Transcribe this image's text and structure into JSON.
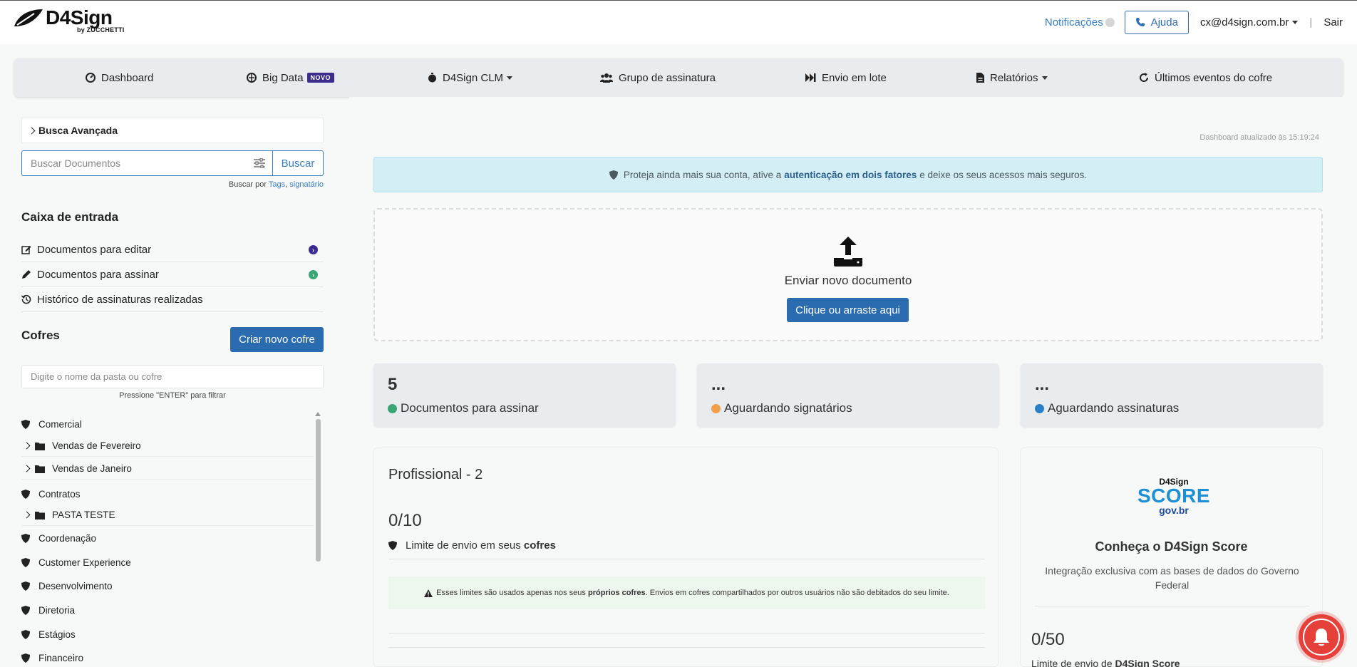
{
  "header": {
    "logo_text": "D4Sign",
    "logo_sub": "by ZUCCHETTI",
    "notifications_label": "Notificações",
    "help_label": "Ajuda",
    "user_email": "cx@d4sign.com.br",
    "separator": "|",
    "logout_label": "Sair"
  },
  "nav": {
    "items": [
      {
        "label": "Dashboard",
        "icon": "dashboard-icon"
      },
      {
        "label": "Big Data",
        "icon": "brain-icon",
        "badge": "NOVO"
      },
      {
        "label": "D4Sign CLM",
        "icon": "stopwatch-icon"
      },
      {
        "label": "Grupo de assinatura",
        "icon": "users-icon"
      },
      {
        "label": "Envio em lote",
        "icon": "fast-forward-icon"
      },
      {
        "label": "Relatórios",
        "icon": "file-report-icon"
      },
      {
        "label": "Últimos eventos do cofre",
        "icon": "refresh-icon"
      }
    ]
  },
  "sidebar": {
    "advanced_search": "Busca Avançada",
    "search_placeholder": "Buscar Documentos",
    "search_button": "Buscar",
    "search_hint_prefix": "Buscar por",
    "search_hint_tags": "Tags",
    "search_hint_sep": ",",
    "search_hint_signer": "signatário",
    "inbox_title": "Caixa de entrada",
    "inbox_items": [
      {
        "label": "Documentos para editar",
        "icon": "edit-icon",
        "badge_color": "#3c2c8f"
      },
      {
        "label": "Documentos para assinar",
        "icon": "pencil-icon",
        "badge_color": "#3aa676"
      },
      {
        "label": "Histórico de assinaturas realizadas",
        "icon": "history-icon"
      }
    ],
    "vaults_title": "Cofres",
    "create_vault_button": "Criar novo cofre",
    "folder_filter_placeholder": "Digite o nome da pasta ou cofre",
    "folder_filter_hint": "Pressione \"ENTER\" para filtrar",
    "tree": [
      {
        "label": "Comercial",
        "type": "vault"
      },
      {
        "label": "Vendas de Fevereiro",
        "type": "folder"
      },
      {
        "label": "Vendas de Janeiro",
        "type": "folder"
      },
      {
        "label": "Contratos",
        "type": "vault"
      },
      {
        "label": "PASTA TESTE",
        "type": "folder"
      },
      {
        "label": "Coordenação",
        "type": "vault"
      },
      {
        "label": "Customer Experience",
        "type": "vault"
      },
      {
        "label": "Desenvolvimento",
        "type": "vault"
      },
      {
        "label": "Diretoria",
        "type": "vault"
      },
      {
        "label": "Estágios",
        "type": "vault"
      },
      {
        "label": "Financeiro",
        "type": "vault"
      }
    ]
  },
  "main": {
    "updated_text": "Dashboard atualizado às 15:19:24",
    "alert_prefix": "Proteja ainda mais sua conta, ative a",
    "alert_link": "autenticação em dois fatores",
    "alert_suffix": "e deixe os seus acessos mais seguros.",
    "upload_title": "Enviar novo documento",
    "upload_button": "Clique ou arraste aqui",
    "stats": [
      {
        "value": "5",
        "label": "Documentos para assinar",
        "color": "#3aa676"
      },
      {
        "value": "...",
        "label": "Aguardando signatários",
        "color": "#f0a04b"
      },
      {
        "value": "...",
        "label": "Aguardando assinaturas",
        "color": "#2b7fc7"
      }
    ],
    "plan": {
      "title": "Profissional - 2",
      "count": "0/10",
      "limit_prefix": "Limite de envio em seus",
      "limit_bold": "cofres",
      "note_prefix": "Esses limites são usados apenas nos seus",
      "note_bold": "próprios cofres",
      "note_suffix": ". Envios em cofres compartilhados por outros usuários não são debitados do seu limite."
    },
    "score": {
      "logo_brand": "D4Sign",
      "logo_score": "SCORE",
      "logo_gov": "gov.br",
      "title": "Conheça o D4Sign Score",
      "desc": "Integração exclusiva com as bases de dados do Governo Federal",
      "count": "0/50",
      "limit_prefix": "Limite de envio de",
      "limit_bold": "D4Sign Score"
    }
  },
  "colors": {
    "primary": "#2b6cb0",
    "link": "#3a7fc1",
    "nav_bg": "#e9ecee",
    "alert_bg": "#d3eef4",
    "new_badge": "#3c2c8f",
    "fab": "#e5413a"
  }
}
